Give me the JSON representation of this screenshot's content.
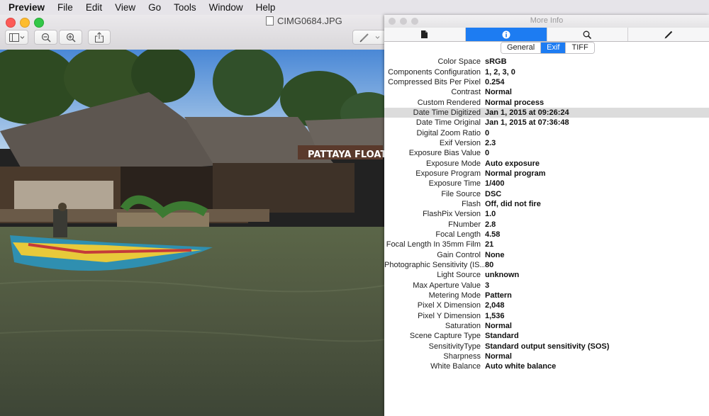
{
  "menubar": {
    "app_name": "Preview",
    "items": [
      "File",
      "Edit",
      "View",
      "Go",
      "Tools",
      "Window",
      "Help"
    ]
  },
  "window": {
    "title": "CIMG0684.JPG",
    "photo_text": "PATTAYA FLOATING"
  },
  "info_panel": {
    "title": "More Info",
    "tabs": [
      {
        "icon": "document-icon"
      },
      {
        "icon": "info-icon",
        "active": true
      },
      {
        "icon": "magnifier-icon"
      },
      {
        "icon": "pencil-icon"
      }
    ],
    "segments": [
      {
        "label": "General",
        "active": false
      },
      {
        "label": "Exif",
        "active": true
      },
      {
        "label": "TIFF",
        "active": false
      }
    ],
    "properties": [
      {
        "key": "Color Space",
        "value": "sRGB"
      },
      {
        "key": "Components Configuration",
        "value": "1, 2, 3, 0"
      },
      {
        "key": "Compressed Bits Per Pixel",
        "value": "0.254"
      },
      {
        "key": "Contrast",
        "value": "Normal"
      },
      {
        "key": "Custom Rendered",
        "value": "Normal process"
      },
      {
        "key": "Date Time Digitized",
        "value": "Jan 1, 2015 at 09:26:24",
        "selected": true
      },
      {
        "key": "Date Time Original",
        "value": "Jan 1, 2015 at 07:36:48"
      },
      {
        "key": "Digital Zoom Ratio",
        "value": "0"
      },
      {
        "key": "Exif Version",
        "value": "2.3"
      },
      {
        "key": "Exposure Bias Value",
        "value": "0"
      },
      {
        "key": "Exposure Mode",
        "value": "Auto exposure"
      },
      {
        "key": "Exposure Program",
        "value": "Normal program"
      },
      {
        "key": "Exposure Time",
        "value": "1/400"
      },
      {
        "key": "File Source",
        "value": "DSC"
      },
      {
        "key": "Flash",
        "value": "Off, did not fire"
      },
      {
        "key": "FlashPix Version",
        "value": "1.0"
      },
      {
        "key": "FNumber",
        "value": "2.8"
      },
      {
        "key": "Focal Length",
        "value": "4.58"
      },
      {
        "key": "Focal Length In 35mm Film",
        "value": "21"
      },
      {
        "key": "Gain Control",
        "value": "None"
      },
      {
        "key": "Photographic Sensitivity (IS...",
        "value": "80"
      },
      {
        "key": "Light Source",
        "value": "unknown"
      },
      {
        "key": "Max Aperture Value",
        "value": "3"
      },
      {
        "key": "Metering Mode",
        "value": "Pattern"
      },
      {
        "key": "Pixel X Dimension",
        "value": "2,048"
      },
      {
        "key": "Pixel Y Dimension",
        "value": "1,536"
      },
      {
        "key": "Saturation",
        "value": "Normal"
      },
      {
        "key": "Scene Capture Type",
        "value": "Standard"
      },
      {
        "key": "SensitivityType",
        "value": "Standard output sensitivity (SOS)"
      },
      {
        "key": "Sharpness",
        "value": "Normal"
      },
      {
        "key": "White Balance",
        "value": "Auto white balance"
      }
    ]
  }
}
